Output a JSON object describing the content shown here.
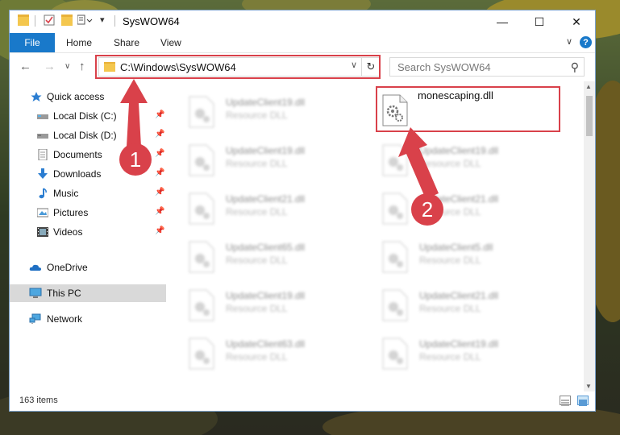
{
  "window": {
    "title": "SysWOW64",
    "controls": {
      "minimize": "—",
      "maximize": "☐",
      "close": "✕"
    }
  },
  "ribbon": {
    "file": "File",
    "tabs": [
      "Home",
      "Share",
      "View"
    ],
    "expand": "∨",
    "help": "?"
  },
  "address": {
    "back": "←",
    "forward": "→",
    "recent": "∨",
    "up": "↑",
    "path": "C:\\Windows\\SysWOW64",
    "dropdown": "∨",
    "refresh": "↻"
  },
  "search": {
    "placeholder": "Search SysWOW64",
    "icon": "search-icon"
  },
  "nav": {
    "items": [
      {
        "label": "Quick access",
        "icon": "star-icon"
      },
      {
        "label": "Local Disk (C:)",
        "icon": "drive-icon",
        "pinned": true
      },
      {
        "label": "Local Disk (D:)",
        "icon": "drive-icon",
        "pinned": true
      },
      {
        "label": "Documents",
        "icon": "documents-icon",
        "pinned": true
      },
      {
        "label": "Downloads",
        "icon": "downloads-icon",
        "pinned": true
      },
      {
        "label": "Music",
        "icon": "music-icon",
        "pinned": true
      },
      {
        "label": "Pictures",
        "icon": "pictures-icon",
        "pinned": true
      },
      {
        "label": "Videos",
        "icon": "videos-icon",
        "pinned": true
      },
      {
        "label": "OneDrive",
        "icon": "cloud-icon"
      },
      {
        "label": "This PC",
        "icon": "computer-icon",
        "selected": true
      },
      {
        "label": "Network",
        "icon": "network-icon"
      }
    ]
  },
  "files": {
    "highlighted": {
      "name": "monescaping.dll",
      "icon": "dll-file-icon"
    },
    "left_column": [
      {
        "name": "UpdateClient19.dll",
        "type": "Resource DLL"
      },
      {
        "name": "UpdateClient19.dll",
        "type": "Resource DLL"
      },
      {
        "name": "UpdateClient21.dll",
        "type": "Resource DLL"
      },
      {
        "name": "UpdateClient65.dll",
        "type": "Resource DLL"
      },
      {
        "name": "UpdateClient19.dll",
        "type": "Resource DLL"
      },
      {
        "name": "UpdateClient63.dll",
        "type": "Resource DLL"
      }
    ],
    "right_column": [
      {
        "name": "UpdateClient19.dll",
        "type": "Resource DLL"
      },
      {
        "name": "UpdateClient21.dll",
        "type": "Resource DLL"
      },
      {
        "name": "UpdateClient5.dll",
        "type": "Resource DLL"
      },
      {
        "name": "UpdateClient21.dll",
        "type": "Resource DLL"
      },
      {
        "name": "UpdateClient19.dll",
        "type": "Resource DLL"
      }
    ]
  },
  "status": {
    "count": "163 items"
  },
  "annotations": {
    "step1": "1",
    "step2": "2",
    "color": "#d9414a"
  },
  "colors": {
    "accent": "#1979ca",
    "selection": "#d9d9d9",
    "highlight": "#d9414a"
  }
}
